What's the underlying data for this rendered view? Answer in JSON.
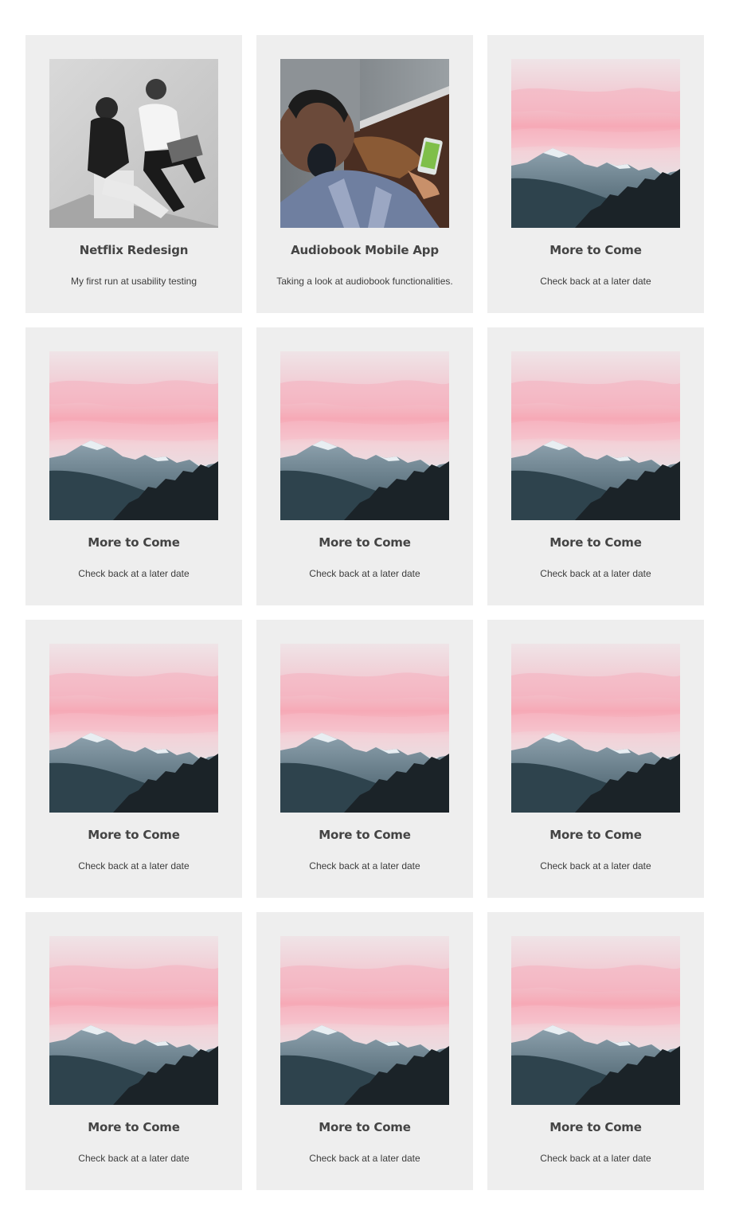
{
  "colors": {
    "page_background": "#ffffff",
    "card_background": "#eeeeee",
    "title_text": "#444444",
    "description_text": "#3d3d3d"
  },
  "projects": [
    {
      "title": "Netflix Redesign",
      "description": "My first run at usability testing",
      "image": "usability-testing-photo"
    },
    {
      "title": "Audiobook Mobile App",
      "description": "Taking a look at audiobook functionalities.",
      "image": "headphones-phone-photo"
    },
    {
      "title": "More to Come",
      "description": "Check back at a later date",
      "image": "pink-sky-mountain-photo"
    },
    {
      "title": "More to Come",
      "description": "Check back at a later date",
      "image": "pink-sky-mountain-photo"
    },
    {
      "title": "More to Come",
      "description": "Check back at a later date",
      "image": "pink-sky-mountain-photo"
    },
    {
      "title": "More to Come",
      "description": "Check back at a later date",
      "image": "pink-sky-mountain-photo"
    },
    {
      "title": "More to Come",
      "description": "Check back at a later date",
      "image": "pink-sky-mountain-photo"
    },
    {
      "title": "More to Come",
      "description": "Check back at a later date",
      "image": "pink-sky-mountain-photo"
    },
    {
      "title": "More to Come",
      "description": "Check back at a later date",
      "image": "pink-sky-mountain-photo"
    },
    {
      "title": "More to Come",
      "description": "Check back at a later date",
      "image": "pink-sky-mountain-photo"
    },
    {
      "title": "More to Come",
      "description": "Check back at a later date",
      "image": "pink-sky-mountain-photo"
    },
    {
      "title": "More to Come",
      "description": "Check back at a later date",
      "image": "pink-sky-mountain-photo"
    }
  ]
}
